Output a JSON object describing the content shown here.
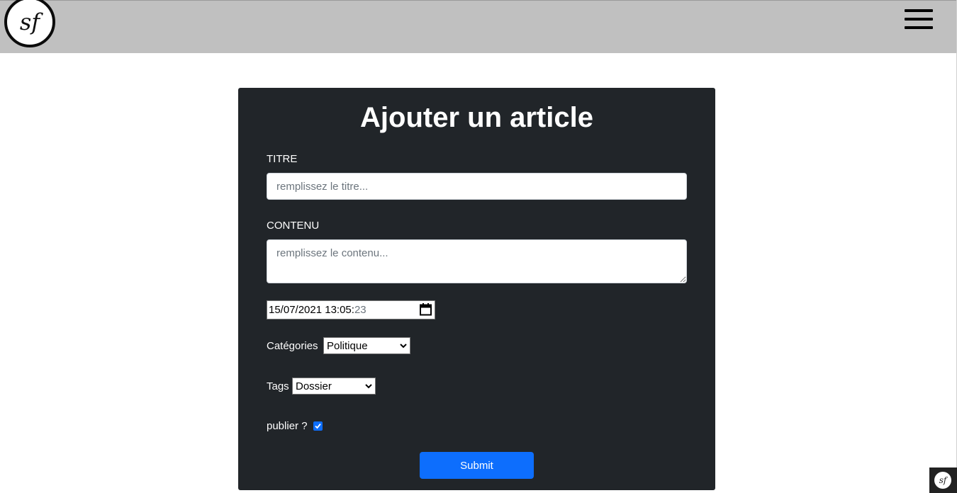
{
  "header": {
    "logo_text": "sf",
    "menu_icon": "hamburger-menu-icon",
    "background": "#c0c0c0"
  },
  "form": {
    "title": "Ajouter un article",
    "titre_label": "TITRE",
    "titre_placeholder": "remplissez le titre...",
    "contenu_label": "CONTENU",
    "contenu_placeholder": "remplissez le contenu...",
    "date_value": "15/07/2021 13:05:",
    "date_seconds": "23",
    "date_icon": "calendar-icon",
    "categories_label": "Catégories",
    "categories_selected": "Politique",
    "tags_label": "Tags",
    "tags_selected": "Dossier",
    "publier_label": "publier ?",
    "publier_checked": true,
    "submit_label": "Submit"
  },
  "toolbar": {
    "logo_text": "sf"
  },
  "colors": {
    "card_bg": "#212529",
    "accent": "#0d6efd",
    "text_light": "#ffffff"
  }
}
